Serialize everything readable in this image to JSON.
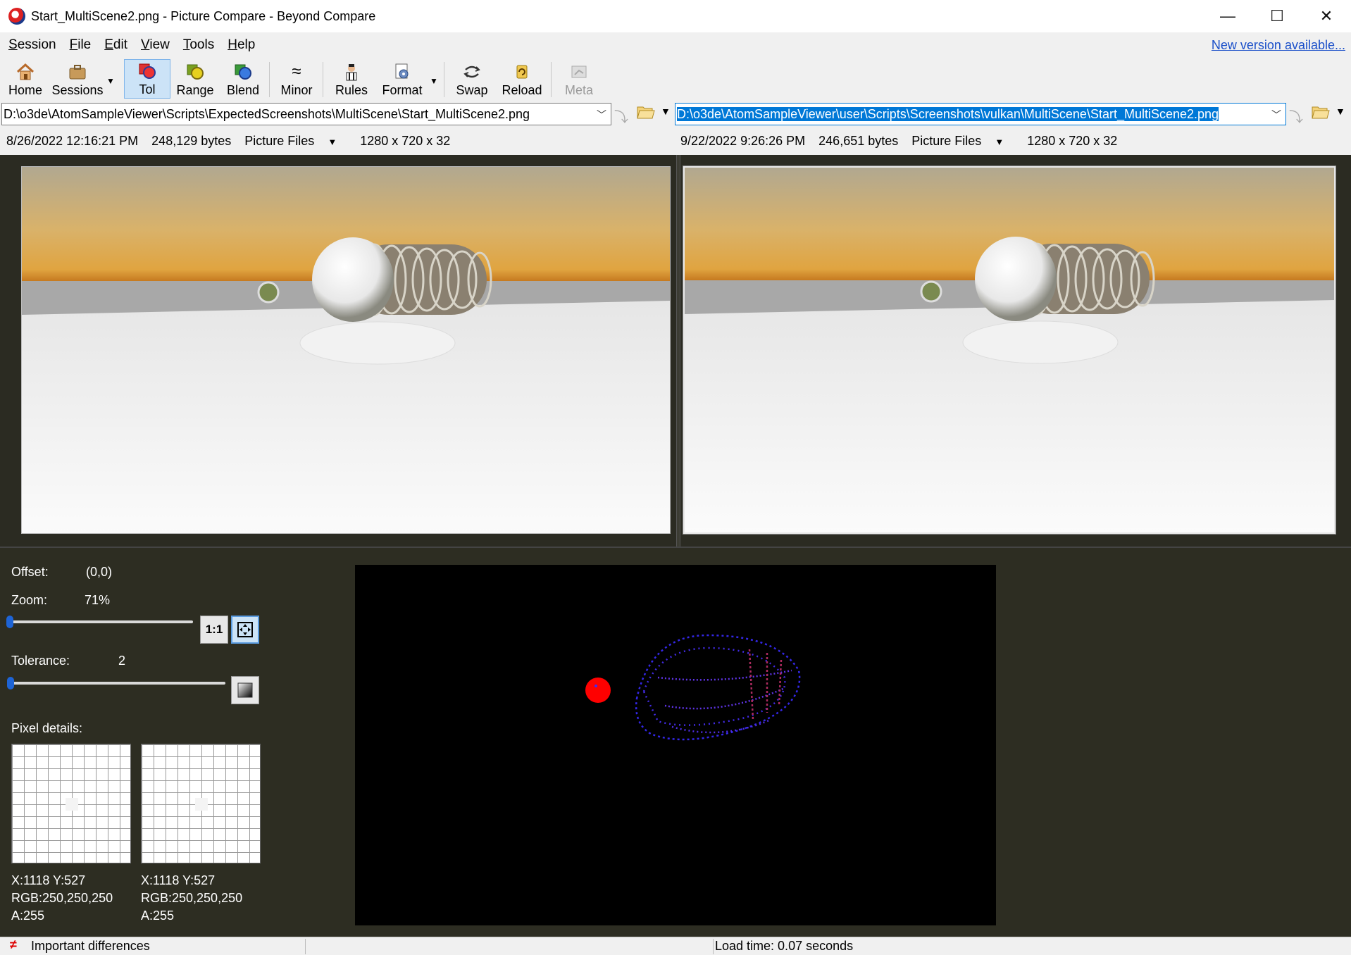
{
  "window": {
    "title": "Start_MultiScene2.png - Picture Compare - Beyond Compare",
    "minimize": "—",
    "maximize": "☐",
    "close": "✕"
  },
  "menu": {
    "items": [
      {
        "label": "Session",
        "ul": "S",
        "rest": "ession"
      },
      {
        "label": "File",
        "ul": "F",
        "rest": "ile"
      },
      {
        "label": "Edit",
        "ul": "E",
        "rest": "dit"
      },
      {
        "label": "View",
        "ul": "V",
        "rest": "iew"
      },
      {
        "label": "Tools",
        "ul": "T",
        "rest": "ools"
      },
      {
        "label": "Help",
        "ul": "H",
        "rest": "elp"
      }
    ],
    "new_version": "New version available..."
  },
  "toolbar": {
    "home": "Home",
    "sessions": "Sessions",
    "tol": "Tol",
    "range": "Range",
    "blend": "Blend",
    "minor": "Minor",
    "rules": "Rules",
    "format": "Format",
    "swap": "Swap",
    "reload": "Reload",
    "meta": "Meta"
  },
  "left": {
    "path": "D:\\o3de\\AtomSampleViewer\\Scripts\\ExpectedScreenshots\\MultiScene\\Start_MultiScene2.png",
    "date": "8/26/2022 12:16:21 PM",
    "size": "248,129 bytes",
    "format": "Picture Files",
    "dims": "1280 x 720 x 32"
  },
  "right": {
    "path": "D:\\o3de\\AtomSampleViewer\\user\\Scripts\\Screenshots\\vulkan\\MultiScene\\Start_MultiScene2.png",
    "date": "9/22/2022 9:26:26 PM",
    "size": "246,651 bytes",
    "format": "Picture Files",
    "dims": "1280 x 720 x 32"
  },
  "panel": {
    "offset_label": "Offset:",
    "offset_value": "(0,0)",
    "zoom_label": "Zoom:",
    "zoom_value": "71%",
    "zoom_level": 0.0,
    "one_to_one": "1:1",
    "tolerance_label": "Tolerance:",
    "tolerance_value": "2",
    "pixel_details_label": "Pixel details:",
    "left_pixel": {
      "xy": "X:1118 Y:527",
      "rgb": "RGB:250,250,250",
      "a": "A:255"
    },
    "right_pixel": {
      "xy": "X:1118 Y:527",
      "rgb": "RGB:250,250,250",
      "a": "A:255"
    }
  },
  "status": {
    "diff": "Important differences",
    "load_time": "Load time: 0.07 seconds"
  },
  "colors": {
    "accent": "#0078d7",
    "link": "#1a4fc9",
    "panel_bg": "#2d2d22",
    "diff_red": "#ff0000",
    "diff_blue": "#3a2cff"
  }
}
